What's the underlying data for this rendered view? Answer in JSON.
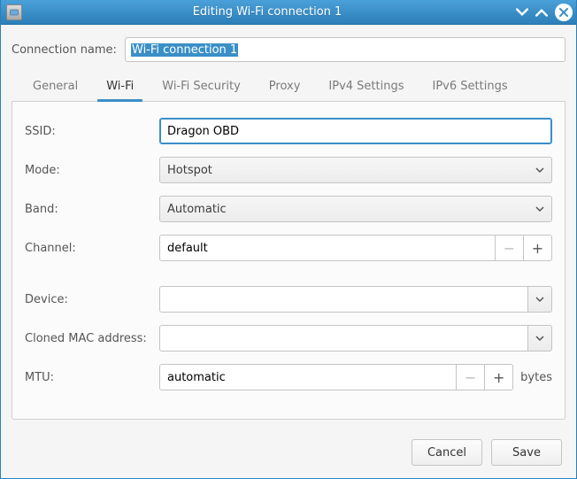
{
  "window": {
    "title": "Editing Wi-Fi connection 1"
  },
  "connection_name": {
    "label": "Connection name:",
    "value": "Wi-Fi connection 1"
  },
  "tabs": {
    "general": "General",
    "wifi": "Wi-Fi",
    "wifi_security": "Wi-Fi Security",
    "proxy": "Proxy",
    "ipv4": "IPv4 Settings",
    "ipv6": "IPv6 Settings"
  },
  "wifi_tab": {
    "ssid": {
      "label": "SSID:",
      "value": "Dragon OBD"
    },
    "mode": {
      "label": "Mode:",
      "value": "Hotspot"
    },
    "band": {
      "label": "Band:",
      "value": "Automatic"
    },
    "channel": {
      "label": "Channel:",
      "value": "default"
    },
    "device": {
      "label": "Device:",
      "value": ""
    },
    "cloned_mac": {
      "label": "Cloned MAC address:",
      "value": ""
    },
    "mtu": {
      "label": "MTU:",
      "value": "automatic",
      "suffix": "bytes"
    }
  },
  "buttons": {
    "cancel": "Cancel",
    "save": "Save"
  },
  "glyphs": {
    "minus": "−",
    "plus": "+"
  }
}
